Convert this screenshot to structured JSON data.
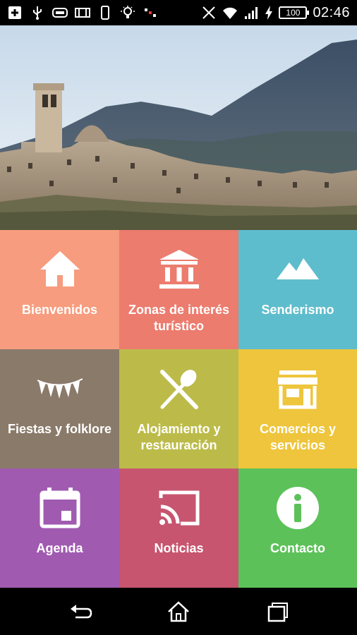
{
  "status_bar": {
    "time": "02:46",
    "battery": "100",
    "icons": [
      "plus-box-icon",
      "usb-icon",
      "gamepad-icon",
      "film-icon",
      "phone-outline-icon",
      "lightbulb-icon",
      "signal-disabled-icon",
      "wifi-icon",
      "signal-bars-icon",
      "charging-bolt-icon"
    ]
  },
  "hero": {
    "image": "hilltop-village-photo"
  },
  "tiles": [
    {
      "label": "Bienvenidos",
      "icon": "home-icon",
      "color": "#F79C7E"
    },
    {
      "label": "Zonas de interés turístico",
      "icon": "museum-icon",
      "color": "#EC7C6E"
    },
    {
      "label": "Senderismo",
      "icon": "mountain-icon",
      "color": "#5EBDCC"
    },
    {
      "label": "Fiestas y folklore",
      "icon": "bunting-icon",
      "color": "#8A7A6A"
    },
    {
      "label": "Alojamiento y restauración",
      "icon": "fork-spoon-icon",
      "color": "#BCBB4A"
    },
    {
      "label": "Comercios y servicios",
      "icon": "store-icon",
      "color": "#EEC53C"
    },
    {
      "label": "Agenda",
      "icon": "calendar-icon",
      "color": "#A05BB1"
    },
    {
      "label": "Noticias",
      "icon": "cast-icon",
      "color": "#C7556F"
    },
    {
      "label": "Contacto",
      "icon": "info-icon",
      "color": "#5DC15A"
    }
  ],
  "navbar": {
    "buttons": [
      "back-icon",
      "home-icon",
      "recents-icon"
    ]
  }
}
